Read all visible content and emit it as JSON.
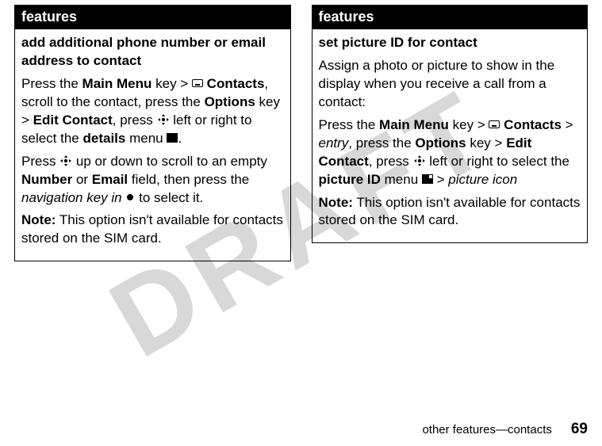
{
  "watermark": "DRAFT",
  "left": {
    "header": "features",
    "title": "add additional phone number or email address to contact",
    "p1_a": "Press the ",
    "p1_mainmenu": "Main Menu",
    "p1_b": " key > ",
    "p1_contacts": " Contacts",
    "p1_c": ", scroll to the contact, press the ",
    "p1_options": "Options",
    "p1_d": " key > ",
    "p1_edit": "Edit Contact",
    "p1_e": ", press ",
    "p1_f": " left or right to select the ",
    "p1_details": "details",
    "p1_g": " menu ",
    "p1_h": ".",
    "p2_a": "Press ",
    "p2_b": " up or down to scroll to an empty ",
    "p2_number": "Number",
    "p2_c": " or ",
    "p2_email": "Email",
    "p2_d": " field, then press the ",
    "p2_nav": "navigation key in",
    "p2_e": " to select it.",
    "note_label": "Note:",
    "note_text": " This option isn't available for contacts stored on the SIM card."
  },
  "right": {
    "header": "features",
    "title": "set picture ID for contact",
    "p1": "Assign a photo or picture to show in the display when you receive a call from a contact:",
    "p2_a": "Press the ",
    "p2_mainmenu": "Main Menu",
    "p2_b": " key > ",
    "p2_contacts": " Contacts",
    "p2_c": " > ",
    "p2_entry": "entry",
    "p2_d": ", press the ",
    "p2_options": "Options",
    "p2_e": " key > ",
    "p2_edit": "Edit Contact",
    "p2_f": ", press ",
    "p2_g": " left or right to select the ",
    "p2_picid": "picture ID",
    "p2_h": " menu ",
    "p2_i": " > ",
    "p2_picicon": "picture icon",
    "note_label": "Note:",
    "note_text": " This option isn't available for contacts stored on the SIM card."
  },
  "footer": {
    "section": "other features—contacts",
    "page": "69"
  }
}
